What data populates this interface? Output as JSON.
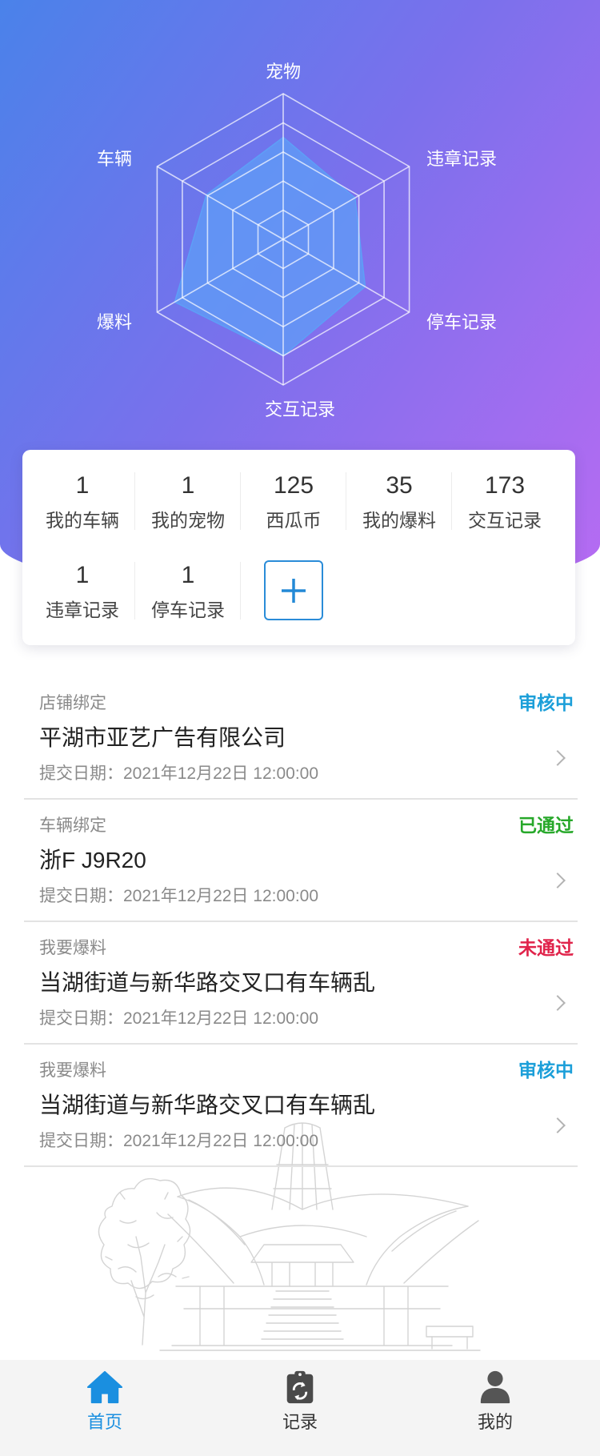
{
  "theme": {
    "gradient_start": "#4a82ea",
    "gradient_end": "#b76bf2",
    "accent": "#1a8fe0"
  },
  "chart_data": {
    "type": "radar",
    "indicators": [
      "宠物",
      "违章记录",
      "停车记录",
      "交互记录",
      "爆料",
      "车辆"
    ],
    "values": [
      0.7,
      0.57,
      0.65,
      0.8,
      0.86,
      0.61
    ],
    "range": [
      0,
      1
    ],
    "grid": true,
    "fill_color": "#5d9ff7",
    "grid_color": "#ffffff"
  },
  "stats": {
    "row1": [
      {
        "value": "1",
        "label": "我的车辆"
      },
      {
        "value": "1",
        "label": "我的宠物"
      },
      {
        "value": "125",
        "label": "西瓜币"
      },
      {
        "value": "35",
        "label": "我的爆料"
      },
      {
        "value": "173",
        "label": "交互记录"
      }
    ],
    "row2": [
      {
        "value": "1",
        "label": "违章记录"
      },
      {
        "value": "1",
        "label": "停车记录"
      }
    ],
    "add_button_icon": "plus-icon"
  },
  "records": [
    {
      "category": "店铺绑定",
      "status": "审核中",
      "status_color": "#1c9fd9",
      "title": "平湖市亚艺广告有限公司",
      "date": "提交日期：2021年12月22日 12:00:00"
    },
    {
      "category": "车辆绑定",
      "status": "已通过",
      "status_color": "#27a82a",
      "title": "浙F J9R20",
      "date": "提交日期：2021年12月22日 12:00:00"
    },
    {
      "category": "我要爆料",
      "status": "未通过",
      "status_color": "#e0234a",
      "title": "当湖街道与新华路交叉口有车辆乱",
      "date": "提交日期：2021年12月22日 12:00:00"
    },
    {
      "category": "我要爆料",
      "status": "审核中",
      "status_color": "#1c9fd9",
      "title": "当湖街道与新华路交叉口有车辆乱",
      "date": "提交日期：2021年12月22日 12:00:00"
    }
  ],
  "record_chevron_icon": "chevron-right-icon",
  "tabbar": {
    "active_color": "#1a8fe0",
    "tabs": [
      {
        "label": "首页",
        "icon": "home-icon",
        "active": true
      },
      {
        "label": "记录",
        "icon": "clipboard-icon",
        "active": false
      },
      {
        "label": "我的",
        "icon": "user-icon",
        "active": false
      }
    ]
  }
}
